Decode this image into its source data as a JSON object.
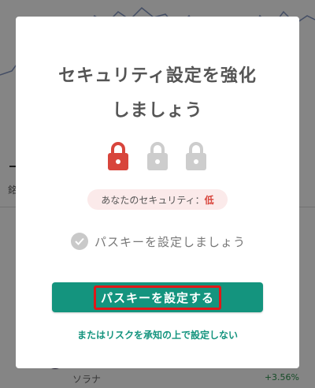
{
  "background": {
    "tab_char": "銘",
    "coin_name": "ソラナ",
    "coin_change": "+3.56%"
  },
  "modal": {
    "title_line1": "セキュリティ設定を強化",
    "title_line2": "しましょう",
    "locks": [
      {
        "icon": "lock-icon",
        "state": "active",
        "color": "#d8453c"
      },
      {
        "icon": "lock-icon",
        "state": "inactive",
        "color": "#cdcdcd"
      },
      {
        "icon": "lock-icon",
        "state": "inactive",
        "color": "#cdcdcd"
      }
    ],
    "security_prefix": "あなたのセキュリティ：",
    "security_level": "低",
    "checklist_item": "パスキーを設定しましょう",
    "primary_button": "パスキーを設定する",
    "skip_link": "またはリスクを承知の上で設定しない"
  },
  "colors": {
    "accent": "#14947e",
    "danger": "#d8453c",
    "highlight_border": "#e01818"
  }
}
